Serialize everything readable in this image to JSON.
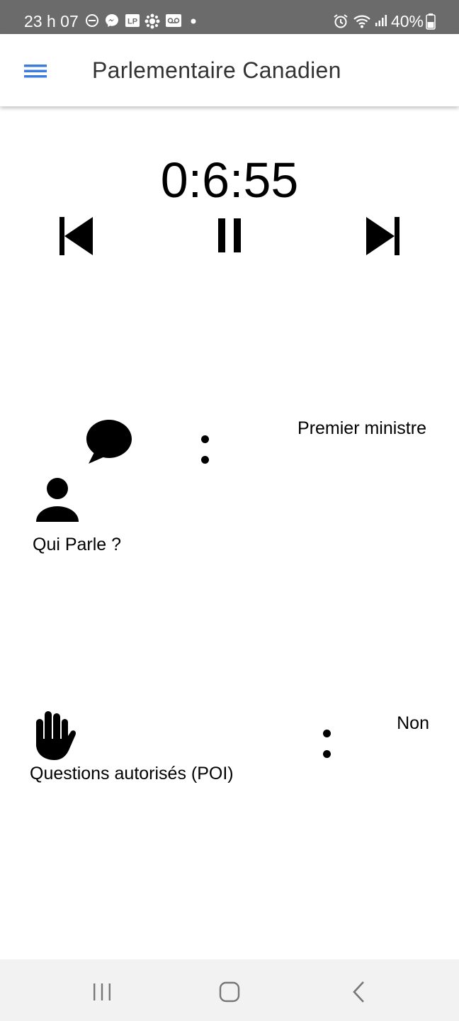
{
  "status_bar": {
    "time": "23 h 07",
    "battery": "40%",
    "icons": [
      "do-not-disturb-icon",
      "messenger-icon",
      "lp-icon",
      "cbc-icon",
      "voicemail-icon",
      "dot-icon",
      "alarm-icon",
      "wifi-icon",
      "signal-icon",
      "battery-icon"
    ],
    "background_color": "#6b6b6b"
  },
  "app_bar": {
    "title": "Parlementaire Canadien",
    "menu_icon": "hamburger-menu-icon",
    "accent_color": "#3b7dd8"
  },
  "timer": {
    "display": "0:6:55"
  },
  "controls": {
    "previous_icon": "skip-previous-icon",
    "pause_icon": "pause-icon",
    "next_icon": "skip-next-icon"
  },
  "speaker": {
    "label": "Qui Parle ?",
    "value": "Premier ministre",
    "icons": [
      "speech-bubble-icon",
      "person-icon"
    ]
  },
  "poi": {
    "label": "Questions autorisés (POI)",
    "value": "Non",
    "icon": "raised-hand-icon"
  },
  "nav_bar": {
    "icons": [
      "recent-apps-icon",
      "home-icon",
      "back-icon"
    ]
  }
}
